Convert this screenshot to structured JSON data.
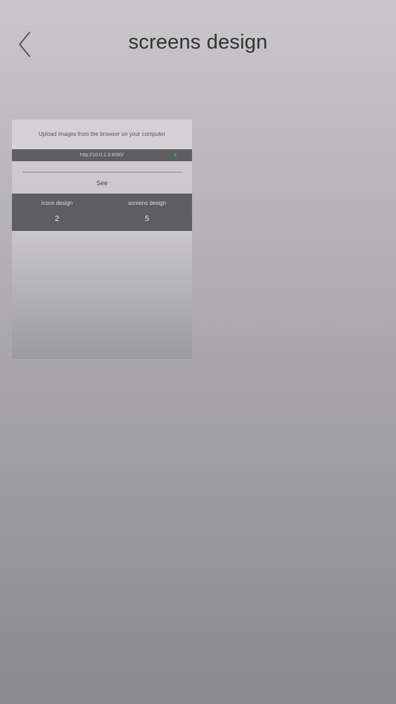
{
  "header": {
    "back_icon": "chevron-left-icon",
    "title": "screens design"
  },
  "thumbnail": {
    "instruction": "Upload images from the browser on your computer",
    "url": "http://10.0.1.3:8080/",
    "status_color": "#3ea86a",
    "see_label": "See",
    "stats": [
      {
        "label": "icons design",
        "value": "2"
      },
      {
        "label": "screens design",
        "value": "5"
      }
    ]
  }
}
